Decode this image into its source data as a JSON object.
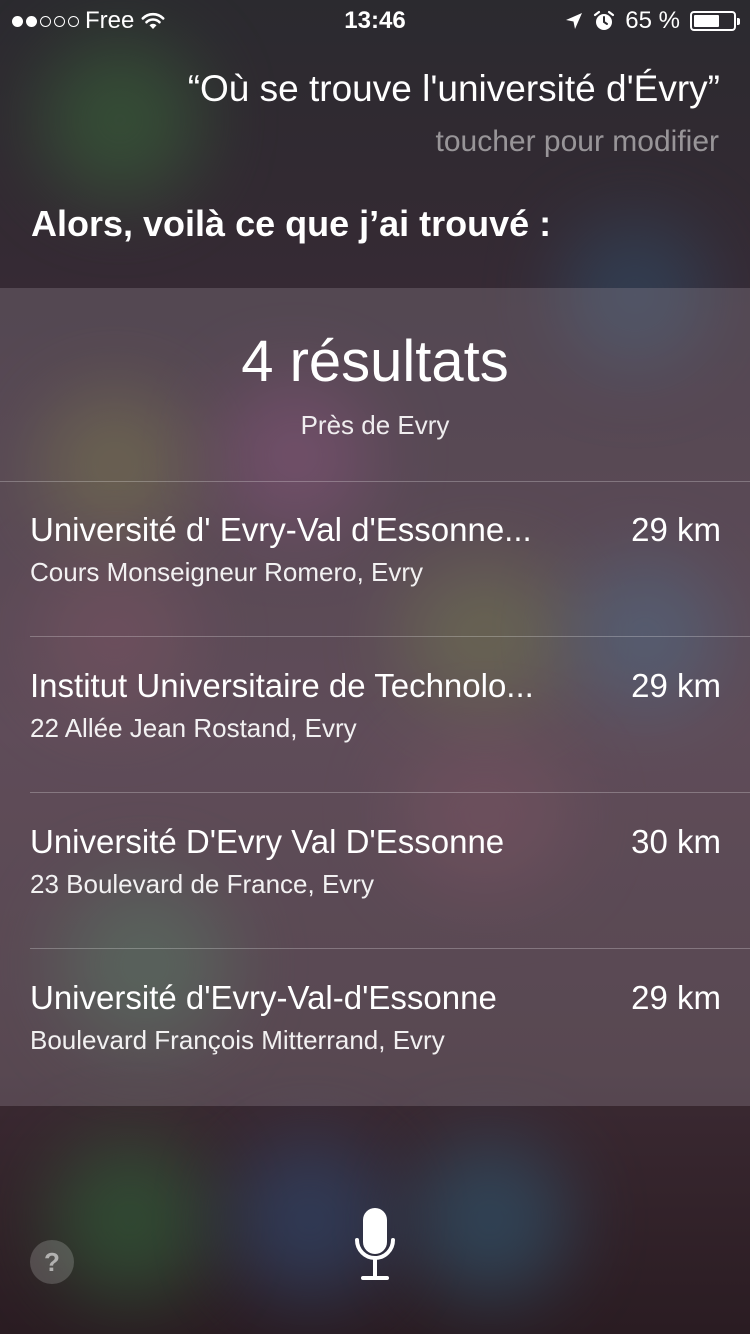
{
  "status_bar": {
    "carrier": "Free",
    "signal_bars": 2,
    "signal_total": 5,
    "time": "13:46",
    "battery_percent": "65 %",
    "battery_level": 0.65
  },
  "siri": {
    "query": "“Où se trouve l'université d'Évry”",
    "edit_hint": "toucher pour modifier",
    "reply": "Alors, voilà ce que j’ai trouvé :"
  },
  "results_card": {
    "count": "4 résultats",
    "near": "Près de Evry",
    "results": [
      {
        "name": "Université d' Evry-Val d'Essonne...",
        "address": "Cours Monseigneur Romero, Evry",
        "distance": "29 km"
      },
      {
        "name": "Institut Universitaire de Technolo...",
        "address": "22 Allée Jean Rostand, Evry",
        "distance": "29 km"
      },
      {
        "name": "Université D'Evry Val D'Essonne",
        "address": "23 Boulevard de France, Evry",
        "distance": "30 km"
      },
      {
        "name": "Université d'Evry-Val-d'Essonne",
        "address": "Boulevard François Mitterrand, Evry",
        "distance": "29 km"
      }
    ]
  },
  "bottom_bar": {
    "help_label": "?",
    "mic_icon": "microphone-icon"
  }
}
